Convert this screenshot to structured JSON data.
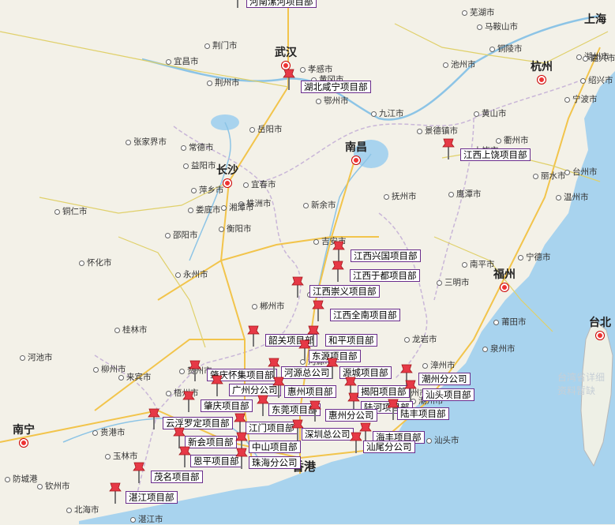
{
  "map": {
    "capitals": [
      "武汉",
      "长沙",
      "南昌",
      "南宁",
      "杭州",
      "福州",
      "上海",
      "台北"
    ],
    "cities": [
      "马鞍山市",
      "芜湖市",
      "铜陵市",
      "池州市",
      "宜昌市",
      "荆门市",
      "孝感市",
      "黄冈市",
      "鄂州市",
      "荆州市",
      "岳阳市",
      "九江市",
      "黄山市",
      "湖州市",
      "嘉兴市",
      "绍兴市",
      "宁波市",
      "衢州市",
      "金华市",
      "台州市",
      "丽水市",
      "温州市",
      "南平市",
      "三明市",
      "宁德市",
      "莆田市",
      "泉州市",
      "漳州市",
      "龙岩市",
      "张家界市",
      "常德市",
      "益阳市",
      "株洲市",
      "湘潭市",
      "娄底市",
      "衡阳市",
      "邵阳市",
      "永州市",
      "郴州市",
      "桂林市",
      "柳州市",
      "河池市",
      "来宾市",
      "贵港市",
      "玉林市",
      "梧州市",
      "贺州市",
      "钦州市",
      "北海市",
      "防城港",
      "上饶市",
      "景德镇市",
      "鹰潭市",
      "抚州市",
      "新余市",
      "宜春市",
      "萍乡市",
      "吉安市",
      "赣州市",
      "铜仁市",
      "怀化市",
      "湛江市",
      "汕头市",
      "河源市",
      "梅州市",
      "潮州市"
    ],
    "hk_label": "香港",
    "watermark": [
      "台湾省详细",
      "资料暂缺"
    ]
  },
  "markers": [
    {
      "label": "河南漯河项目部"
    },
    {
      "label": "湖北咸宁项目部"
    },
    {
      "label": "江西上饶项目部"
    },
    {
      "label": "江西兴国项目部"
    },
    {
      "label": "江西于都项目部"
    },
    {
      "label": "江西崇义项目部"
    },
    {
      "label": "江西全南项目部"
    },
    {
      "label": "韶关项目部"
    },
    {
      "label": "和平项目部"
    },
    {
      "label": "东源项目部"
    },
    {
      "label": "肇庆怀集项目部"
    },
    {
      "label": "河源总公司"
    },
    {
      "label": "源城项目部"
    },
    {
      "label": "潮州分公司"
    },
    {
      "label": "广州分公司"
    },
    {
      "label": "惠州项目部"
    },
    {
      "label": "揭阳项目部"
    },
    {
      "label": "汕头项目部"
    },
    {
      "label": "肇庆项目部"
    },
    {
      "label": "陆河项目部"
    },
    {
      "label": "东莞项目部"
    },
    {
      "label": "陆丰项目部"
    },
    {
      "label": "云浮罗定项目部"
    },
    {
      "label": "惠州分公司"
    },
    {
      "label": "江门项目部"
    },
    {
      "label": "新会项目部"
    },
    {
      "label": "深圳总公司"
    },
    {
      "label": "海丰项目部"
    },
    {
      "label": "中山项目部"
    },
    {
      "label": "汕尾分公司"
    },
    {
      "label": "恩平项目部"
    },
    {
      "label": "珠海分公司"
    },
    {
      "label": "茂名项目部"
    },
    {
      "label": "湛江项目部"
    }
  ]
}
